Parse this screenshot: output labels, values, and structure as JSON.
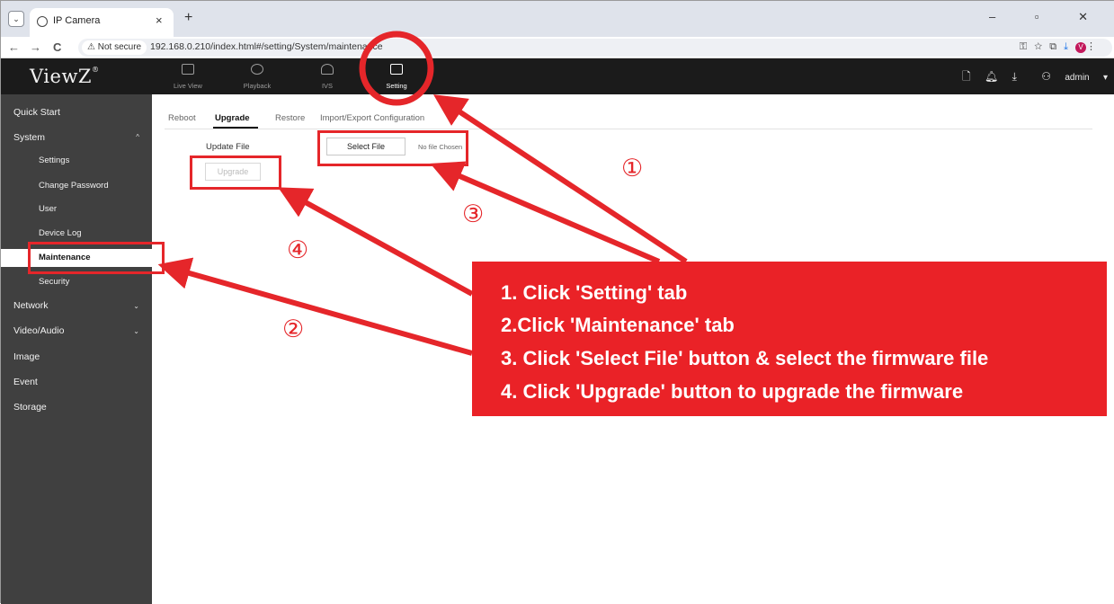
{
  "browser": {
    "tab_title": "IP Camera",
    "tab_close": "×",
    "new_tab": "+",
    "window_controls": "– ▫ ✕",
    "back": "←",
    "forward": "→",
    "reload": "C",
    "security_chip": "⚠ Not secure",
    "url": "192.168.0.210/index.html#/setting/System/maintenance"
  },
  "header": {
    "logo": "ViewZ",
    "nav": [
      {
        "label": "Live View",
        "icon": "live-view-icon"
      },
      {
        "label": "Playback",
        "icon": "playback-icon"
      },
      {
        "label": "IVS",
        "icon": "ivs-icon"
      },
      {
        "label": "Setting",
        "icon": "setting-icon",
        "active": true
      }
    ],
    "user": "admin"
  },
  "sidebar": {
    "items": [
      {
        "label": "Quick Start"
      },
      {
        "label": "System",
        "expanded": true,
        "chevron": "^"
      },
      {
        "label": "Settings",
        "sub": true
      },
      {
        "label": "Change Password",
        "sub": true
      },
      {
        "label": "User",
        "sub": true
      },
      {
        "label": "Device Log",
        "sub": true
      },
      {
        "label": "Maintenance",
        "sub": true,
        "active": true
      },
      {
        "label": "Security",
        "sub": true
      },
      {
        "label": "Network",
        "chevron": "v"
      },
      {
        "label": "Video/Audio",
        "chevron": "v"
      },
      {
        "label": "Image"
      },
      {
        "label": "Event"
      },
      {
        "label": "Storage"
      }
    ]
  },
  "content": {
    "tabs": [
      {
        "label": "Reboot"
      },
      {
        "label": "Upgrade",
        "active": true
      },
      {
        "label": "Restore"
      },
      {
        "label": "Import/Export Configuration"
      }
    ],
    "update_file_label": "Update File",
    "select_file_button": "Select File",
    "no_file_text": "No file Chosen",
    "upgrade_button": "Upgrade"
  },
  "annotations": {
    "accent_color": "#ea2227",
    "step_labels": [
      "①",
      "②",
      "③",
      "④"
    ],
    "instructions": [
      "1. Click 'Setting' tab",
      "2.Click 'Maintenance' tab",
      "3. Click 'Select File' button & select the firmware file",
      "4. Click 'Upgrade' button to upgrade the firmware"
    ]
  }
}
